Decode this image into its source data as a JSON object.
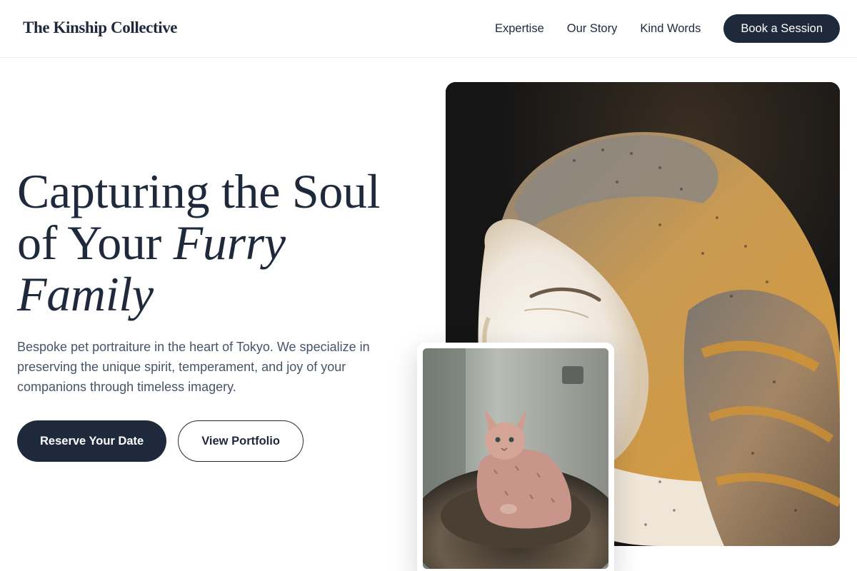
{
  "header": {
    "brand": "The Kinship Collective",
    "nav": [
      "Expertise",
      "Our Story",
      "Kind Words"
    ],
    "cta": "Book a Session"
  },
  "hero": {
    "title_line1": "Capturing the Soul",
    "title_line2_plain": "of Your ",
    "title_line2_italic": "Furry",
    "title_line3_italic": "Family",
    "subtitle": "Bespoke pet portraiture in the heart of Tokyo. We specialize in preserving the unique spirit, temperament, and joy of your companions through timeless imagery.",
    "primary_button": "Reserve Your Date",
    "secondary_button": "View Portfolio"
  },
  "images": {
    "main": "barn-owl-photo",
    "inset": "hairless-cat-in-sweater-photo"
  },
  "colors": {
    "primary": "#1e293b",
    "body_text": "#475569",
    "background": "#ffffff"
  }
}
